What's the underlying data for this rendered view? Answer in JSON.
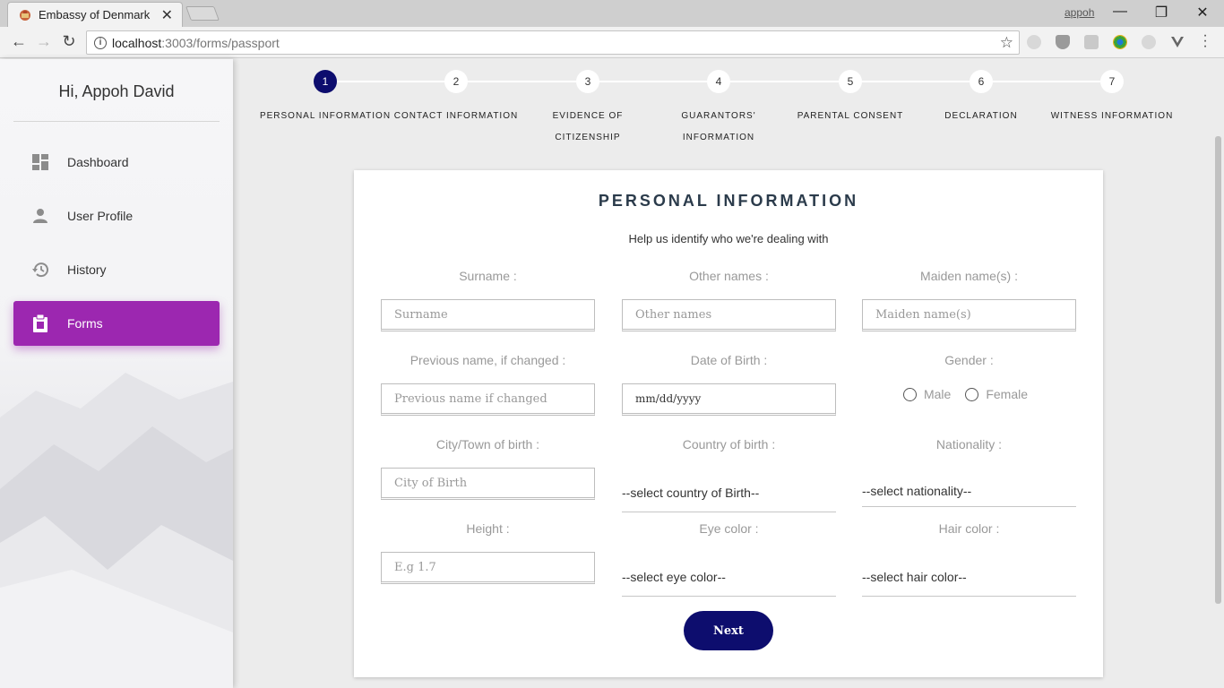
{
  "browser": {
    "tab_title": "Embassy of Denmark",
    "tab_close": "✕",
    "profile_name": "appoh",
    "url_host": "localhost",
    "url_path": ":3003/forms/passport",
    "win_minimize": "—",
    "win_restore": "❐",
    "win_close": "✕"
  },
  "sidebar": {
    "greeting": "Hi, Appoh David",
    "items": [
      {
        "label": "Dashboard",
        "icon": "dashboard-icon",
        "active": false
      },
      {
        "label": "User Profile",
        "icon": "person-icon",
        "active": false
      },
      {
        "label": "History",
        "icon": "history-icon",
        "active": false
      },
      {
        "label": "Forms",
        "icon": "clipboard-icon",
        "active": true
      }
    ]
  },
  "stepper": {
    "steps": [
      {
        "number": "1",
        "label": "PERSONAL INFORMATION",
        "active": true
      },
      {
        "number": "2",
        "label": "CONTACT INFORMATION",
        "active": false
      },
      {
        "number": "3",
        "label": "EVIDENCE OF CITIZENSHIP",
        "active": false
      },
      {
        "number": "4",
        "label": "GUARANTORS' INFORMATION",
        "active": false
      },
      {
        "number": "5",
        "label": "PARENTAL CONSENT",
        "active": false
      },
      {
        "number": "6",
        "label": "DECLARATION",
        "active": false
      },
      {
        "number": "7",
        "label": "WITNESS INFORMATION",
        "active": false
      }
    ]
  },
  "form": {
    "title": "PERSONAL INFORMATION",
    "subtitle": "Help us identify who we're dealing with",
    "surname": {
      "label": "Surname :",
      "placeholder": "Surname"
    },
    "other_names": {
      "label": "Other names :",
      "placeholder": "Other names"
    },
    "maiden_names": {
      "label": "Maiden name(s) :",
      "placeholder": "Maiden name(s)"
    },
    "previous_name": {
      "label": "Previous name, if changed :",
      "placeholder": "Previous name if changed"
    },
    "dob": {
      "label": "Date of Birth :",
      "value": "mm/dd/yyyy"
    },
    "gender": {
      "label": "Gender :",
      "option_male": "Male",
      "option_female": "Female"
    },
    "city_of_birth": {
      "label": "City/Town of birth :",
      "placeholder": "City of Birth"
    },
    "country_of_birth": {
      "label": "Country of birth :",
      "value": "--select country of Birth--"
    },
    "nationality": {
      "label": "Nationality :",
      "value": "--select nationality--"
    },
    "height": {
      "label": "Height :",
      "placeholder": "E.g 1.7"
    },
    "eye_color": {
      "label": "Eye color :",
      "value": "--select eye color--"
    },
    "hair_color": {
      "label": "Hair color :",
      "value": "--select hair color--"
    },
    "next_label": "Next"
  },
  "colors": {
    "accent_purple": "#9c27b0",
    "navy": "#0d0d6e"
  }
}
